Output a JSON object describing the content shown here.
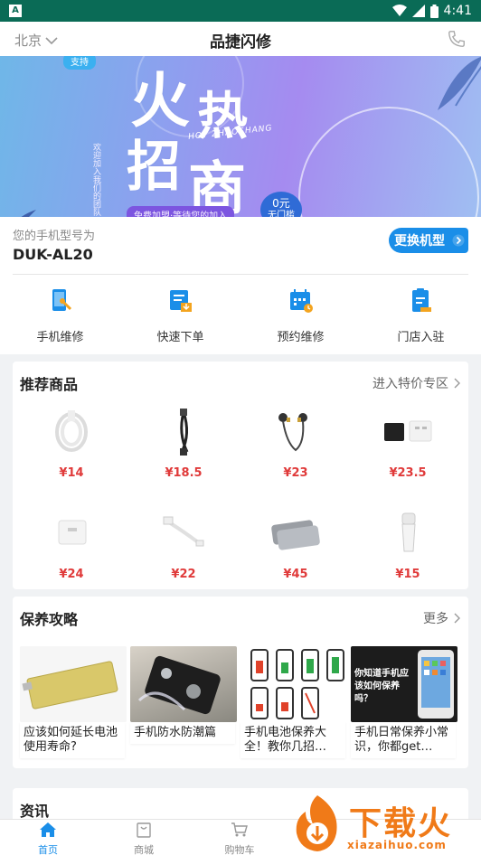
{
  "status_bar": {
    "time": "4:41",
    "app_glyph": "A"
  },
  "header": {
    "city": "北京",
    "title": "品捷闪修"
  },
  "banner": {
    "tag": "支持",
    "big_1": "火",
    "big_2": "热",
    "big_3": "招",
    "big_4": "商",
    "vertical_text": "欢迎加入我们的团队",
    "english": "HOT ZHAOSHANG",
    "badge_line1": "0元",
    "badge_line2": "无门槛",
    "ribbon": "免费加盟·等待您的加入"
  },
  "model": {
    "label": "您的手机型号为",
    "value": "DUK-AL20",
    "button": "更换机型"
  },
  "quick_menu": [
    {
      "label": "手机维修",
      "icon": "phone-repair-icon"
    },
    {
      "label": "快速下单",
      "icon": "quick-order-icon"
    },
    {
      "label": "预约维修",
      "icon": "calendar-icon"
    },
    {
      "label": "门店入驻",
      "icon": "store-form-icon"
    }
  ],
  "products": {
    "title": "推荐商品",
    "more": "进入特价专区",
    "items": [
      {
        "price": "¥14",
        "icon": "usb-cable-white-icon"
      },
      {
        "price": "¥18.5",
        "icon": "usb-cable-black-icon"
      },
      {
        "price": "¥23",
        "icon": "earphones-icon"
      },
      {
        "price": "¥23.5",
        "icon": "dual-charger-icon"
      },
      {
        "price": "¥24",
        "icon": "wall-charger-icon"
      },
      {
        "price": "¥22",
        "icon": "short-cable-icon"
      },
      {
        "price": "¥45",
        "icon": "power-bank-icon"
      },
      {
        "price": "¥15",
        "icon": "car-charger-icon"
      }
    ]
  },
  "guides": {
    "title": "保养攻略",
    "more": "更多",
    "items": [
      {
        "text": "应该如何延长电池使用寿命?"
      },
      {
        "text": "手机防水防潮篇"
      },
      {
        "text": "手机电池保养大全！教你几招…"
      },
      {
        "text": "手机日常保养小常识，你都get…",
        "overlay": "你知道手机应该如何保养吗？"
      }
    ]
  },
  "news": {
    "title": "资讯"
  },
  "bottom_nav": [
    {
      "label": "首页",
      "icon": "home-icon"
    },
    {
      "label": "商城",
      "icon": "shop-bag-icon"
    },
    {
      "label": "购物车",
      "icon": "cart-icon"
    },
    {
      "label": "",
      "icon": ""
    },
    {
      "label": "",
      "icon": ""
    }
  ],
  "watermark": {
    "text": "下载火",
    "sub": "xiazaihuo.com"
  },
  "colors": {
    "accent": "#1a8ee8",
    "price": "#e03a3a",
    "status_bar": "#0a6b56",
    "watermark": "#f07a18"
  }
}
